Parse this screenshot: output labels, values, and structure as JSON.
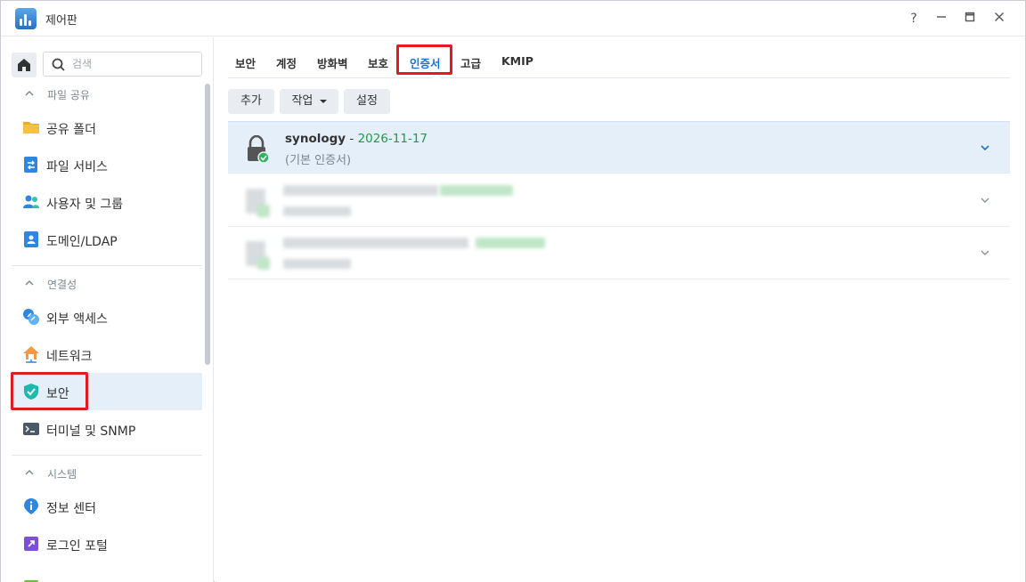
{
  "window": {
    "title": "제어판"
  },
  "controls": {
    "help": "?",
    "minimize": "—",
    "maximize": "□",
    "close": "✕"
  },
  "search": {
    "placeholder": "검색",
    "value": ""
  },
  "sidebar": {
    "sections": [
      {
        "label": "파일 공유",
        "items": [
          {
            "label": "공유 폴더",
            "icon": "folder-icon"
          },
          {
            "label": "파일 서비스",
            "icon": "file-services-icon"
          },
          {
            "label": "사용자 및 그룹",
            "icon": "users-icon"
          },
          {
            "label": "도메인/LDAP",
            "icon": "domain-icon"
          }
        ]
      },
      {
        "label": "연결성",
        "items": [
          {
            "label": "외부 액세스",
            "icon": "external-access-icon"
          },
          {
            "label": "네트워크",
            "icon": "network-icon"
          },
          {
            "label": "보안",
            "icon": "shield-icon",
            "active": true
          },
          {
            "label": "터미널 및 SNMP",
            "icon": "terminal-icon"
          }
        ]
      },
      {
        "label": "시스템",
        "items": [
          {
            "label": "정보 센터",
            "icon": "info-icon"
          },
          {
            "label": "로그인 포털",
            "icon": "login-portal-icon"
          }
        ]
      }
    ]
  },
  "tabs": [
    {
      "label": "보안"
    },
    {
      "label": "계정"
    },
    {
      "label": "방화벽"
    },
    {
      "label": "보호"
    },
    {
      "label": "인증서",
      "active": true
    },
    {
      "label": "고급"
    },
    {
      "label": "KMIP"
    }
  ],
  "toolbar": {
    "add": "추가",
    "action": "작업",
    "settings": "설정"
  },
  "certificates": [
    {
      "name": "synology",
      "separator": " - ",
      "expiry": "2026-11-17",
      "subtitle": "(기본 인증서)",
      "selected": true
    }
  ],
  "colors": {
    "accent": "#1a73d1",
    "highlight": "#e01b24",
    "expiry": "#1e9a4b",
    "selected_bg": "#e5eff9"
  }
}
